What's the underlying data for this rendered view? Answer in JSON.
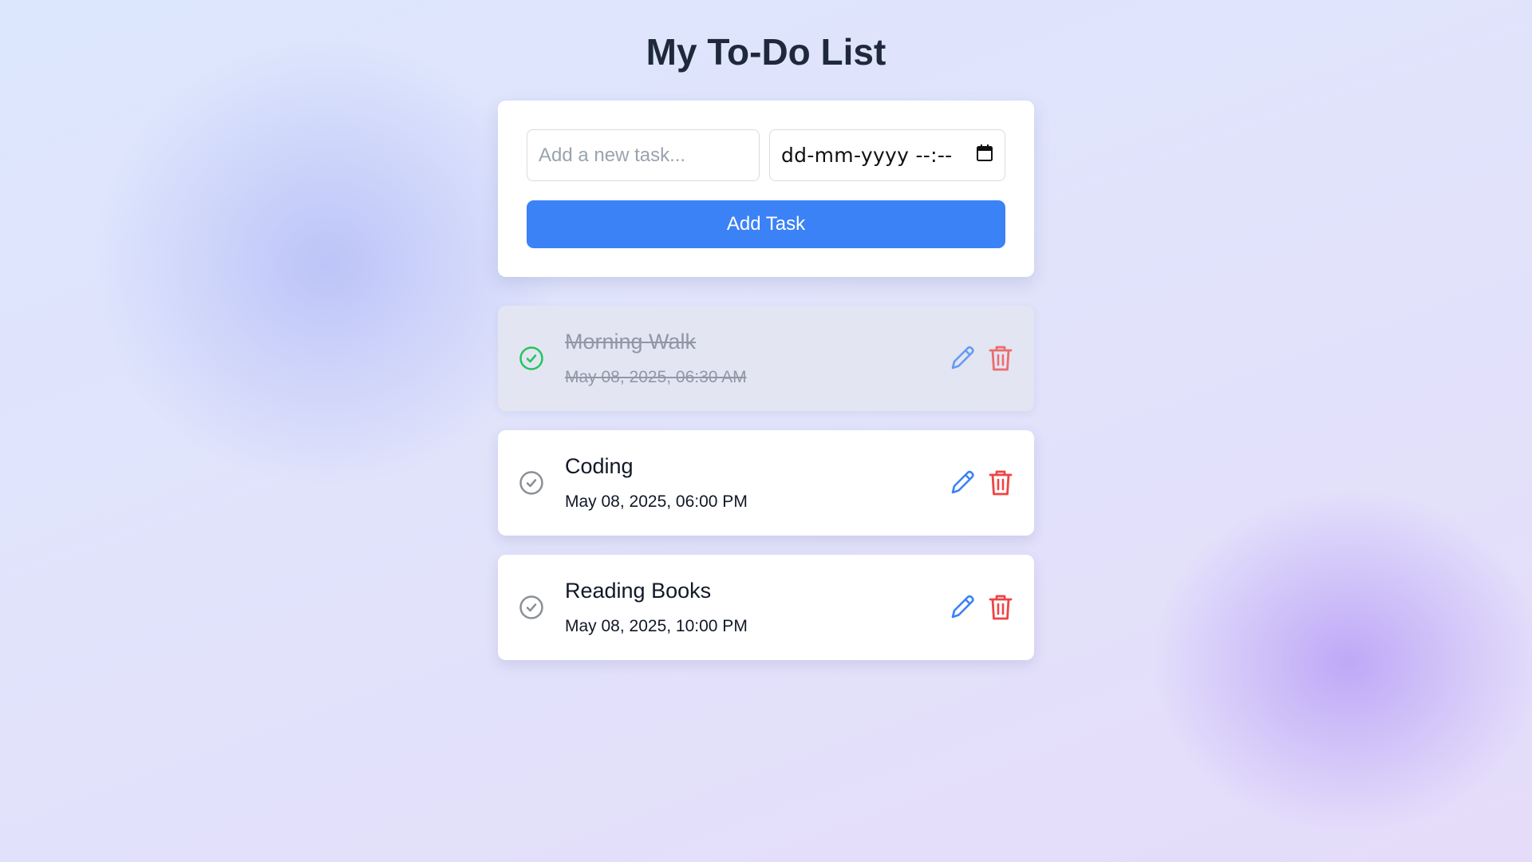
{
  "header": {
    "title": "My To-Do List"
  },
  "form": {
    "task_placeholder": "Add a new task...",
    "task_value": "",
    "datetime_placeholder": "dd-mm-yyyy --:--",
    "add_button_label": "Add Task"
  },
  "tasks": [
    {
      "title": "Morning Walk",
      "datetime": "May 08, 2025, 06:30 AM",
      "completed": true
    },
    {
      "title": "Coding",
      "datetime": "May 08, 2025, 06:00 PM",
      "completed": false
    },
    {
      "title": "Reading Books",
      "datetime": "May 08, 2025, 10:00 PM",
      "completed": false
    }
  ],
  "icons": {
    "complete": "check-circle-icon",
    "edit": "pencil-icon",
    "delete": "trash-icon",
    "calendar": "calendar-icon"
  },
  "colors": {
    "accent": "#3b82f6",
    "complete_check": "#22c55e",
    "pending_check": "#8b8f97",
    "delete": "#ef4444",
    "edit": "#3b82f6"
  }
}
